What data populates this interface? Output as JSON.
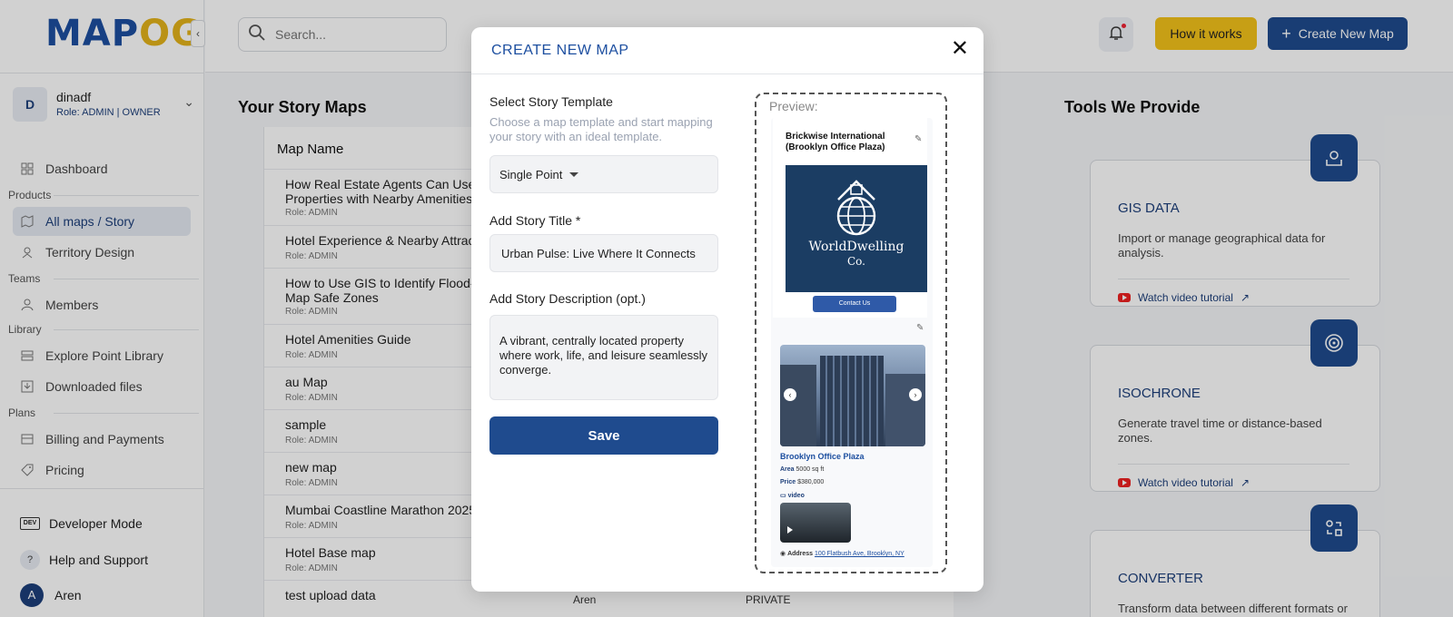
{
  "brand": {
    "logo_main": "MAP",
    "logo_accent": "OG"
  },
  "user": {
    "initial": "D",
    "name": "dinadf",
    "role_prefix": "Role: ADMIN | ",
    "role_owner": "OWNER"
  },
  "sidebar": {
    "dashboard": "Dashboard",
    "section_products": "Products",
    "all_maps": "All maps / Story",
    "territory": "Territory Design",
    "section_teams": "Teams",
    "members": "Members",
    "section_library": "Library",
    "explore": "Explore Point Library",
    "downloaded": "Downloaded files",
    "section_plans": "Plans",
    "billing": "Billing and Payments",
    "pricing": "Pricing",
    "dev_badge": "DEV",
    "developer_mode": "Developer Mode",
    "help": "Help and Support",
    "account_initial": "A",
    "account_name": "Aren"
  },
  "topbar": {
    "search_placeholder": "Search...",
    "how_it_works": "How it works",
    "create_new_map": "Create New Map"
  },
  "main": {
    "title": "Your Story Maps",
    "column_name": "Map Name",
    "rows": [
      {
        "name": "How Real Estate Agents Can Use Map",
        "name2": "Properties with Nearby Amenities",
        "role": "Role: ADMIN"
      },
      {
        "name": "Hotel Experience & Nearby Attractions",
        "name2": "",
        "role": "Role: ADMIN"
      },
      {
        "name": "How to Use GIS to Identify Flood-Prone",
        "name2": "Map Safe Zones",
        "role": "Role: ADMIN"
      },
      {
        "name": "Hotel Amenities Guide",
        "name2": "",
        "role": "Role: ADMIN"
      },
      {
        "name": "au Map",
        "name2": "",
        "role": "Role: ADMIN"
      },
      {
        "name": "sample",
        "name2": "",
        "role": "Role: ADMIN"
      },
      {
        "name": "new map",
        "name2": "",
        "role": "Role: ADMIN"
      },
      {
        "name": "Mumbai Coastline Marathon 2025",
        "name2": "",
        "role": "Role: ADMIN"
      },
      {
        "name": "Hotel Base map",
        "name2": "",
        "role": "Role: ADMIN"
      },
      {
        "name": "test upload data",
        "name2": "",
        "role": ""
      }
    ],
    "last_row_owner": "Aren",
    "last_row_visibility": "PRIVATE"
  },
  "tools": {
    "title": "Tools We Provide",
    "video_label": "Watch video tutorial",
    "cards": [
      {
        "name": "GIS DATA",
        "desc": "Import or manage geographical data for analysis.",
        "icon": "map-upload-icon"
      },
      {
        "name": "ISOCHRONE",
        "desc": "Generate travel time or distance-based zones.",
        "icon": "target-icon"
      },
      {
        "name": "CONVERTER",
        "desc": "Transform data between different formats or types.",
        "icon": "convert-icon"
      }
    ]
  },
  "modal": {
    "title": "CREATE NEW MAP",
    "template_label": "Select Story Template",
    "template_hint": "Choose a map template and start mapping your story with an ideal template.",
    "template_value": "Single Point",
    "story_title_label": "Add Story Title *",
    "story_title_value": "Urban Pulse: Live Where It Connects",
    "story_desc_label": "Add Story Description (opt.)",
    "story_desc_value": "A vibrant, centrally located property where work, life, and leisure seamlessly converge.",
    "save": "Save"
  },
  "preview": {
    "label": "Preview:",
    "card_title": "Brickwise International (Brooklyn Office Plaza)",
    "logo_line1": "WorldDwelling",
    "logo_line2": "Co.",
    "contact_button": "Contact Us",
    "place_name": "Brooklyn Office Plaza",
    "area_label": "Area",
    "area_value": "5000 sq ft",
    "price_label": "Price",
    "price_value": "$380,000",
    "video_label": "video",
    "address_label": "Address",
    "address_value": "100 Flatbush Ave, Brooklyn, NY"
  },
  "colors": {
    "primary": "#1f4b8e",
    "accent": "#f3c21a",
    "brand_blue": "#1d4fa0"
  }
}
